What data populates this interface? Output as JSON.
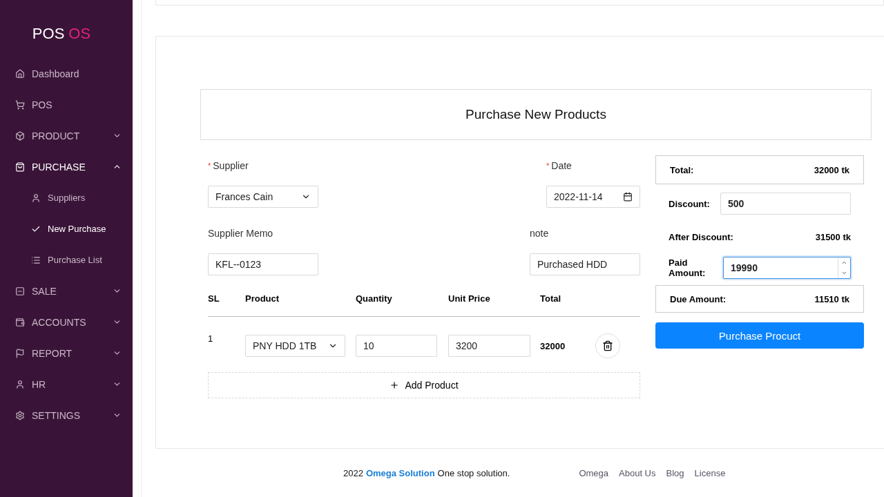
{
  "brand": {
    "first": "POS",
    "second": "OS"
  },
  "sidebar": {
    "items": [
      {
        "label": "Dashboard",
        "kind": "link",
        "selected": false
      },
      {
        "label": "POS",
        "kind": "link",
        "selected": false
      },
      {
        "label": "PRODUCT",
        "kind": "group",
        "expanded": false,
        "selected": false
      },
      {
        "label": "PURCHASE",
        "kind": "group",
        "expanded": true,
        "selected": true,
        "children": [
          {
            "label": "Suppliers",
            "selected": false
          },
          {
            "label": "New Purchase",
            "selected": true
          },
          {
            "label": "Purchase List",
            "selected": false
          }
        ]
      },
      {
        "label": "SALE",
        "kind": "group",
        "expanded": false,
        "selected": false
      },
      {
        "label": "ACCOUNTS",
        "kind": "group",
        "expanded": false,
        "selected": false
      },
      {
        "label": "REPORT",
        "kind": "group",
        "expanded": false,
        "selected": false
      },
      {
        "label": "HR",
        "kind": "group",
        "expanded": false,
        "selected": false
      },
      {
        "label": "SETTINGS",
        "kind": "group",
        "expanded": false,
        "selected": false
      }
    ]
  },
  "form": {
    "title": "Purchase New Products",
    "supplier": {
      "required_mark": "*",
      "label": "Supplier",
      "value": "Frances Cain"
    },
    "date": {
      "required_mark": "*",
      "label": "Date",
      "value": "2022-11-14"
    },
    "memo": {
      "label": "Supplier Memo",
      "value": "KFL--0123"
    },
    "note": {
      "label": "note",
      "value": "Purchased HDD"
    },
    "table": {
      "columns": [
        "SL",
        "Product",
        "Quantity",
        "Unit Price",
        "Total"
      ],
      "rows": [
        {
          "sl": "1",
          "product": "PNY HDD 1TB",
          "quantity": "10",
          "unit_price": "3200",
          "total": "32000"
        }
      ]
    },
    "add_button": "Add Product"
  },
  "summary": {
    "total": {
      "label": "Total:",
      "value": "32000 tk"
    },
    "discount": {
      "label": "Discount:",
      "value": "500"
    },
    "after_discount": {
      "label": "After Discount:",
      "value": "31500 tk"
    },
    "paid": {
      "label": "Paid Amount:",
      "value": "19990"
    },
    "due": {
      "label": "Due Amount:",
      "value": "11510 tk"
    },
    "button": "Purchase Procuct"
  },
  "footer": {
    "year": "2022",
    "company": "Omega Solution",
    "tagline": "One stop solution.",
    "links": [
      "Omega",
      "About Us",
      "Blog",
      "License"
    ]
  }
}
